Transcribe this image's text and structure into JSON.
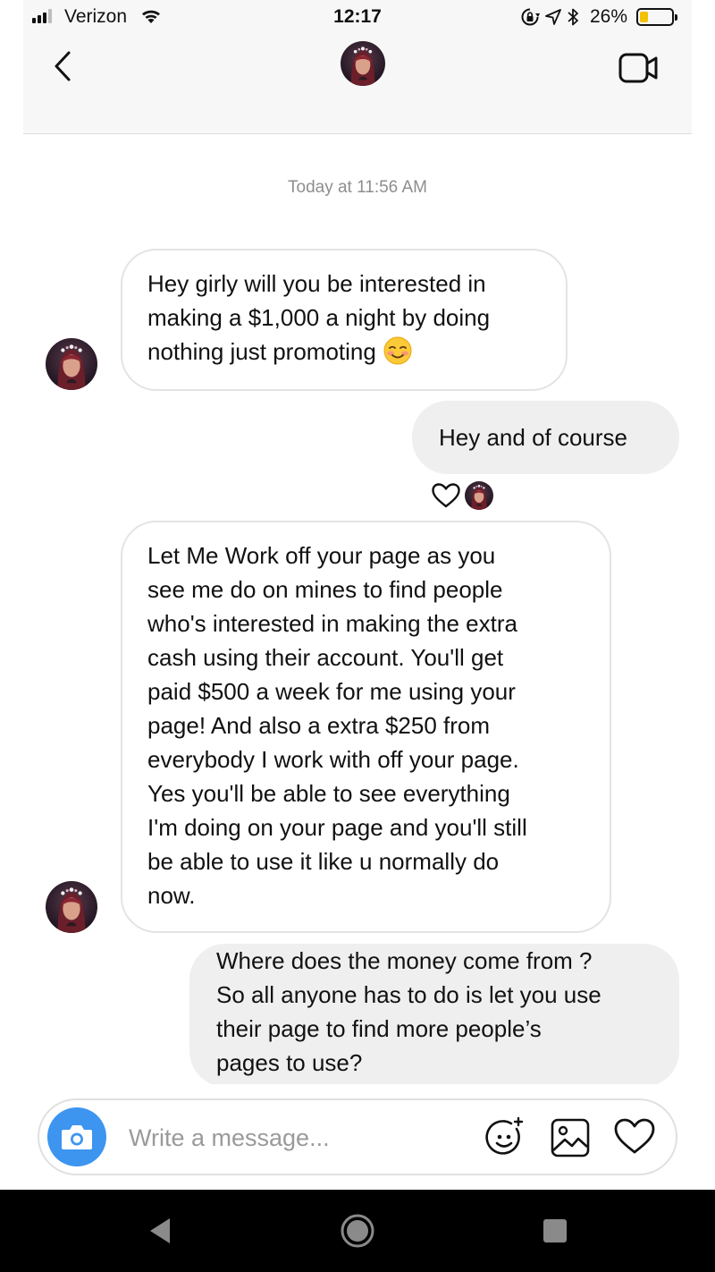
{
  "status_bar": {
    "carrier": "Verizon",
    "time": "12:17",
    "battery_percent": "26%",
    "battery_level": 0.26,
    "icons": [
      "signal-icon",
      "wifi-icon",
      "rotation-lock-icon",
      "location-icon",
      "bluetooth-icon",
      "battery-icon"
    ]
  },
  "header": {
    "back_icon": "chevron-left-icon",
    "avatar": "profile-avatar",
    "video_icon": "video-camera-icon"
  },
  "thread": {
    "timestamp": "Today at 11:56 AM",
    "messages": [
      {
        "direction": "incoming",
        "lines": [
          "Hey girly will you be interested in",
          "making a $1,000 a night by doing",
          "nothing just promoting"
        ],
        "emoji": "smiling-face-with-blush-emoji"
      },
      {
        "direction": "outgoing",
        "lines": [
          "Hey and of course"
        ],
        "reaction": "heart-outline-icon"
      },
      {
        "direction": "incoming",
        "lines": [
          "Let Me Work off your page as you",
          "see me do on mines to find people",
          "who's interested in making the extra",
          "cash using their account. You'll get",
          "paid $500 a week for me using your",
          "page! And also a extra $250 from",
          "everybody I work with off your page.",
          "Yes you'll be able to see everything",
          "I'm doing on your page and you'll still",
          "be able to use it like u normally do",
          "now."
        ]
      },
      {
        "direction": "outgoing",
        "lines": [
          "Where does the money come from ?",
          "So all anyone has to do is let you use",
          "their page to find more people’s",
          "pages to use?"
        ]
      }
    ]
  },
  "composer": {
    "placeholder": "Write a message...",
    "camera_icon": "camera-icon",
    "sticker_icon": "sticker-smiley-icon",
    "gallery_icon": "image-gallery-icon",
    "like_icon": "heart-outline-icon"
  },
  "nav_bar": {
    "icons": [
      "nav-back-icon",
      "nav-home-icon",
      "nav-recents-icon"
    ]
  },
  "colors": {
    "accent_blue": "#3d95f0",
    "outgoing_bubble": "#efefef",
    "incoming_border": "#e3e3e3",
    "timestamp_gray": "#8e8e8e",
    "battery_yellow": "#f2c200"
  }
}
